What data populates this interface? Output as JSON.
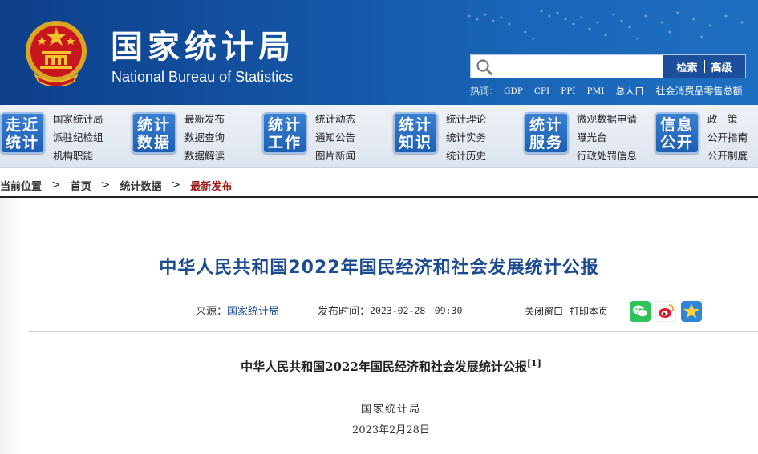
{
  "header": {
    "title_cn": "国家统计局",
    "title_en": "National Bureau of Statistics",
    "search": {
      "placeholder": "",
      "search_label": "检索",
      "advanced_label": "高级"
    },
    "hot_label": "热词:",
    "hot_words": [
      "GDP",
      "CPI",
      "PPI",
      "PMI",
      "总人口",
      "社会消费品零售总额"
    ]
  },
  "nav": [
    {
      "badge": [
        "走近",
        "统计"
      ],
      "links": [
        "国家统计局",
        "派驻纪检组",
        "机构职能"
      ]
    },
    {
      "badge": [
        "统计",
        "数据"
      ],
      "links": [
        "最新发布",
        "数据查询",
        "数据解读"
      ]
    },
    {
      "badge": [
        "统计",
        "工作"
      ],
      "links": [
        "统计动态",
        "通知公告",
        "图片新闻"
      ]
    },
    {
      "badge": [
        "统计",
        "知识"
      ],
      "links": [
        "统计理论",
        "统计实务",
        "统计历史"
      ]
    },
    {
      "badge": [
        "统计",
        "服务"
      ],
      "links": [
        "微观数据申请",
        "曝光台",
        "行政处罚信息"
      ]
    },
    {
      "badge": [
        "信息",
        "公开"
      ],
      "links": [
        "政　策",
        "公开指南",
        "公开制度"
      ]
    }
  ],
  "breadcrumb": {
    "label": "当前位置",
    "items": [
      "首页",
      "统计数据",
      "最新发布"
    ]
  },
  "article": {
    "title": "中华人民共和国2022年国民经济和社会发展统计公报",
    "source_label": "来源：",
    "source": "国家统计局",
    "date_label": "发布时间：",
    "date": "2023-02-28　09:30",
    "close_label": "关闭窗口",
    "print_label": "打印本页",
    "share_icons": [
      "wechat-icon",
      "weibo-icon",
      "favorite-icon"
    ],
    "body_title": "中华人民共和国2022年国民经济和社会发展统计公报",
    "footnote_mark": "[1]",
    "issuer": "国家统计局",
    "issue_date": "2023年2月28日"
  },
  "colors": {
    "header_blue": "#1557a8",
    "title_blue": "#1d4b8f",
    "breadcrumb_current": "#9a1b1b",
    "nav_badge": "#1f5fb2"
  }
}
